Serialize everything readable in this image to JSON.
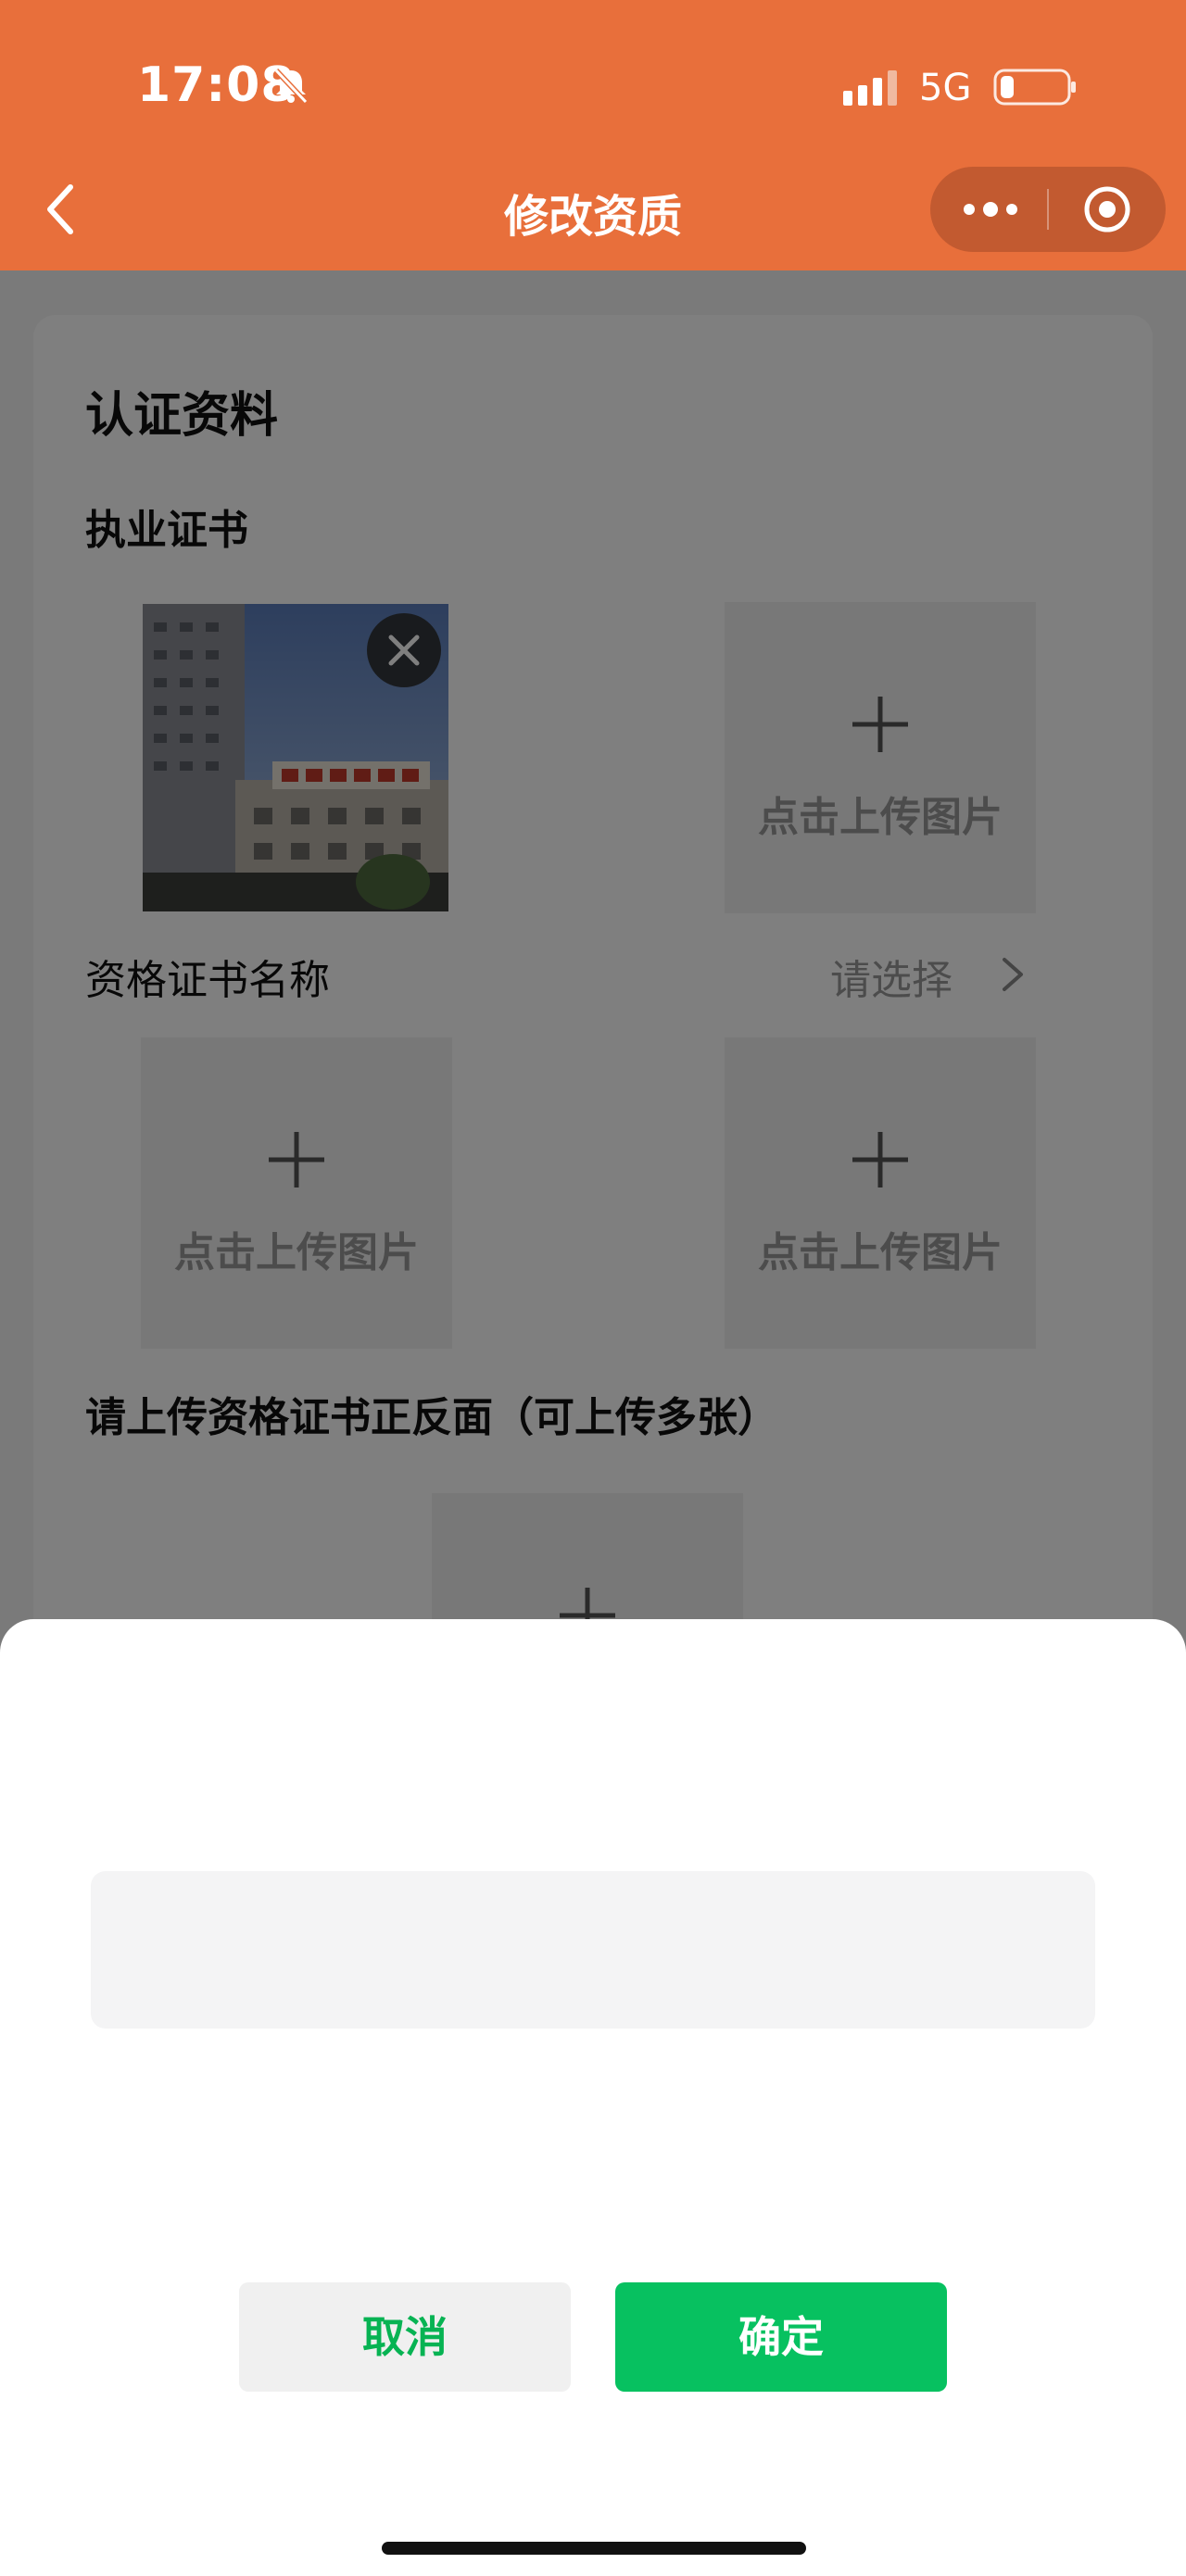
{
  "status_bar": {
    "time": "17:08",
    "network": "5G",
    "icons": [
      "bell-mute-icon",
      "signal-icon",
      "battery-icon"
    ]
  },
  "nav": {
    "title": "修改资质",
    "icons": [
      "back-icon",
      "more-icon",
      "target-icon"
    ]
  },
  "form": {
    "section_title": "认证资料",
    "license_label": "执业证书",
    "cert_name_label": "资格证书名称",
    "cert_name_value": "请选择",
    "upload_note": "请上传资格证书正反面（可上传多张）",
    "upload_tile_text": "点击上传图片"
  },
  "dialog": {
    "input_value": "",
    "input_placeholder": "",
    "cancel_label": "取消",
    "confirm_label": "确定"
  },
  "colors": {
    "header": "#e86f3b",
    "confirm_button": "#07c160",
    "cancel_text": "#07b353"
  }
}
